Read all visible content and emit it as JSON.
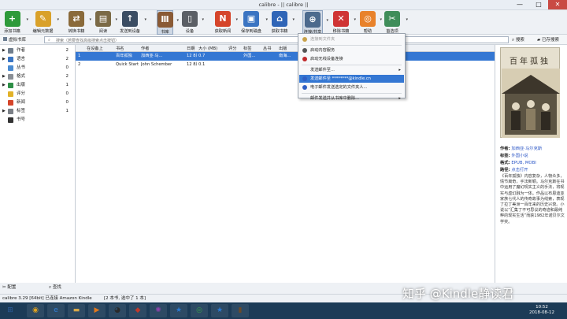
{
  "window": {
    "title": "calibre - || calibre ||",
    "min": "—",
    "max": "□",
    "close": "✕"
  },
  "toolbar": [
    {
      "label": "添加书籍",
      "icon": "add-book-icon",
      "color": "#2e9a3a",
      "glyph": "+",
      "x": 3,
      "w": 25
    },
    {
      "label": "编辑元数据",
      "icon": "edit-metadata-icon",
      "color": "#d9a12a",
      "glyph": "✎",
      "x": 42,
      "w": 25
    },
    {
      "label": "转换书籍",
      "icon": "convert-book-icon",
      "color": "#8a6a3a",
      "glyph": "⇄",
      "x": 86,
      "w": 22
    },
    {
      "label": "阅读",
      "icon": "read-book-icon",
      "color": "#7b6a46",
      "glyph": "▤",
      "x": 121,
      "w": 20
    },
    {
      "label": "发送到设备",
      "icon": "send-to-device-icon",
      "color": "#3b4d63",
      "glyph": "↑",
      "x": 152,
      "w": 26
    },
    {
      "label": "书库",
      "icon": "library-icon",
      "color": "#8a5a35",
      "glyph": "Ⅲ",
      "x": 199,
      "w": 21,
      "active": true
    },
    {
      "label": "设备",
      "icon": "device-icon",
      "color": "#5b5f66",
      "glyph": "▯",
      "x": 231,
      "w": 20
    },
    {
      "label": "获取新闻",
      "icon": "fetch-news-icon",
      "color": "#d5452a",
      "glyph": "N",
      "x": 272,
      "w": 22
    },
    {
      "label": "保存到磁盘",
      "icon": "save-to-disk-icon",
      "color": "#3a74c2",
      "glyph": "▣",
      "x": 306,
      "w": 26
    },
    {
      "label": "获取书籍",
      "icon": "get-books-icon",
      "color": "#2f65b7",
      "glyph": "⌂",
      "x": 344,
      "w": 22
    },
    {
      "label": "连接/共享",
      "icon": "connect-share-icon",
      "color": "#4c6a8d",
      "glyph": "⊕",
      "x": 384,
      "w": 26,
      "active": true
    },
    {
      "label": "移除书籍",
      "icon": "remove-books-icon",
      "color": "#cf3434",
      "glyph": "✕",
      "x": 422,
      "w": 22
    },
    {
      "label": "帮助",
      "icon": "help-icon",
      "color": "#e8822b",
      "glyph": "◎",
      "x": 457,
      "w": 20
    },
    {
      "label": "首选项",
      "icon": "preferences-icon",
      "color": "#3f8d5a",
      "glyph": "✂",
      "x": 486,
      "w": 24
    }
  ],
  "virtual_library": {
    "label": "虚拟书库"
  },
  "search": {
    "placeholder": "搜索（若要查找高级搜索点击按钮）",
    "search_label": "搜索",
    "saved_label": "已存搜索"
  },
  "sidebar": {
    "items": [
      {
        "name": "作者",
        "count": "2",
        "icon": "author-icon",
        "color": "#6f7d8c",
        "tri": "▶"
      },
      {
        "name": "语言",
        "count": "2",
        "icon": "language-icon",
        "color": "#3a76c4",
        "tri": "▶"
      },
      {
        "name": "丛书",
        "count": "0",
        "icon": "series-icon",
        "color": "#4a8bd1",
        "tri": ""
      },
      {
        "name": "格式",
        "count": "2",
        "icon": "format-icon",
        "color": "#8a8f96",
        "tri": "▶"
      },
      {
        "name": "出版",
        "count": "1",
        "icon": "publisher-icon",
        "color": "#2e8f47",
        "tri": "▶"
      },
      {
        "name": "评分",
        "count": "0",
        "icon": "rating-icon",
        "color": "#e2b229",
        "tri": ""
      },
      {
        "name": "新闻",
        "count": "0",
        "icon": "news-icon",
        "color": "#d5452a",
        "tri": ""
      },
      {
        "name": "标签",
        "count": "1",
        "icon": "tag-icon",
        "color": "#7a7f86",
        "tri": "▶"
      },
      {
        "name": "书号",
        "count": "",
        "icon": "isbn-icon",
        "color": "#333333",
        "tri": ""
      }
    ],
    "configure": "配置",
    "find": "查找"
  },
  "table": {
    "headers": [
      "",
      "在设备上",
      "书名",
      "作者",
      "日期",
      "大小 (MB)",
      "评分",
      "标签",
      "丛书",
      "出版"
    ],
    "rows": [
      {
        "num": "1",
        "on_device": "",
        "title": "百年孤独",
        "author": "加西亚·马…",
        "date": "12 8月 2018",
        "size": "0.7",
        "rating": "",
        "tags": "外国…",
        "series": "",
        "publisher": "南海…",
        "selected": true
      },
      {
        "num": "2",
        "on_device": "",
        "title": "Quick Start Guide",
        "author": "John Schember",
        "date": "12 8月 2018",
        "size": "0.1",
        "rating": "",
        "tags": "",
        "series": "",
        "publisher": "",
        "selected": false
      }
    ]
  },
  "menu": {
    "items": [
      {
        "label": "连接到文件夹",
        "icon": "folder-icon",
        "color": "#c9a24a",
        "disabled": true
      },
      {
        "label": "启动内容服务",
        "icon": "server-icon",
        "color": "#555555"
      },
      {
        "label": "启动无线设备连接",
        "icon": "wireless-icon",
        "color": "#c0292b"
      },
      {
        "label": "发送邮件至...",
        "icon": "",
        "color": "",
        "submenu": true
      },
      {
        "label": "发送邮件至 ********@kindle.cn",
        "icon": "email-icon",
        "color": "#2f5fc4",
        "highlight": true
      },
      {
        "label": "电子邮件发送选定的文件夹人...",
        "icon": "email-people-icon",
        "color": "#2f5fc4"
      },
      {
        "label": "邮件发送并从书库中删除...",
        "icon": "",
        "color": "",
        "submenu": true
      }
    ]
  },
  "detail": {
    "cover_title": "百年孤独",
    "author_label": "作者:",
    "author": "加西亚·马尔克斯",
    "tags_label": "标签:",
    "tags": "外国小说",
    "formats_label": "格式:",
    "formats": "EPUB, MOBI",
    "path_label": "路径:",
    "path": "点击打开",
    "comment": "《百年孤独》内容复杂，人物众多，情节离奇，手法新颖。马尔克斯在书中运用了魔幻现实主义的手法，将现实与虚幻融为一体。作品以布恩迪亚家族七代人的传奇故事为线索，表现了拉丁美洲一百年来的历史兴衰。小说以“汇集了不可思议的奇迹和最纯粹的现实生活”而获1982年诺贝尔文学奖。"
  },
  "status": {
    "text": "calibre 3.29 [64bit] 已连接 Amazon Kindle",
    "count": "[2 本书, 选中了 1 本]"
  },
  "watermark": "知乎 @Kindle静读君",
  "taskbar": {
    "icons": [
      {
        "name": "start-icon",
        "glyph": "⊞",
        "color": "#2d5e9c"
      },
      {
        "name": "chrome-icon",
        "glyph": "◉",
        "color": "#e0a21e"
      },
      {
        "name": "ie-icon",
        "glyph": "e",
        "color": "#2f7fd8"
      },
      {
        "name": "explorer-icon",
        "glyph": "▬",
        "color": "#d8a94a"
      },
      {
        "name": "media-icon",
        "glyph": "▶",
        "color": "#e0781e"
      },
      {
        "name": "qq-icon",
        "glyph": "◕",
        "color": "#2a2a2a"
      },
      {
        "name": "app-icon",
        "glyph": "◆",
        "color": "#c0392b"
      },
      {
        "name": "pinwheel-icon",
        "glyph": "✺",
        "color": "#8e44ad"
      },
      {
        "name": "star-app-icon",
        "glyph": "★",
        "color": "#2a7ad4"
      },
      {
        "name": "chrome2-icon",
        "glyph": "◎",
        "color": "#3aa14c"
      },
      {
        "name": "kindle-icon",
        "glyph": "★",
        "color": "#2a7ad4"
      },
      {
        "name": "calibre-icon",
        "glyph": "▮",
        "color": "#6a4a2a"
      }
    ],
    "time": "10:52",
    "date": "2018-08-12"
  }
}
